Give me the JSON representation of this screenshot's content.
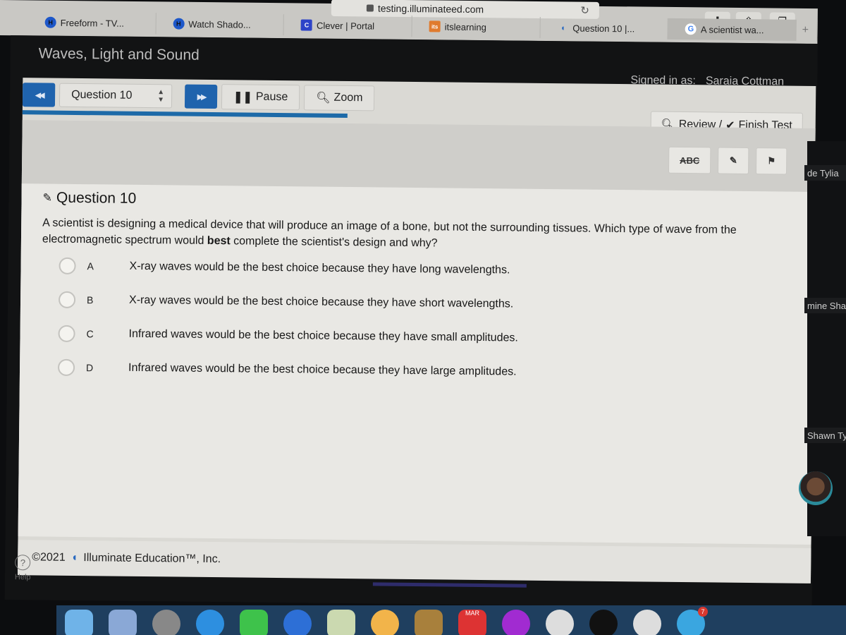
{
  "browser": {
    "url": "testing.illuminateed.com",
    "tabs": [
      {
        "label": "Freeform - TV...",
        "icon": "h-logo-icon"
      },
      {
        "label": "Watch Shado...",
        "icon": "h-logo-icon"
      },
      {
        "label": "Clever | Portal",
        "icon": "clever-logo-icon"
      },
      {
        "label": "itslearning",
        "icon": "itslearning-logo-icon"
      },
      {
        "label": "Question 10 |...",
        "icon": "illuminate-logo-icon"
      },
      {
        "label": "A scientist wa...",
        "icon": "google-logo-icon"
      }
    ],
    "new_tab_label": "+",
    "favicon_glyphs": {
      "h": "H",
      "c": "C",
      "its": "its",
      "ill": "◖",
      "g": "G"
    }
  },
  "app": {
    "title": "Waves, Light and Sound",
    "signed_in_label": "Signed in as:",
    "user_name": "Saraia Cottman"
  },
  "toolbar": {
    "prev_label": "◀◀",
    "question_select": "Question 10",
    "next_label": "▶▶",
    "pause_label": "Pause",
    "zoom_label": "Zoom",
    "review_label": "Review /",
    "finish_label": "Finish Test",
    "progress_fraction": 0.41,
    "tools": {
      "abc": "ABC",
      "edit": "✎",
      "flag": "⚑"
    }
  },
  "question": {
    "heading": "Question 10",
    "stem_before": "A scientist is designing a medical device that will produce an image of a bone, but not the surrounding tissues. Which type of wave from the electromagnetic spectrum would ",
    "stem_bold": "best",
    "stem_after": " complete the scientist's design and why?",
    "choices": [
      {
        "letter": "A",
        "text": "X-ray waves would be the best choice because they have long wavelengths."
      },
      {
        "letter": "B",
        "text": "X-ray waves would be the best choice because they have short wavelengths."
      },
      {
        "letter": "C",
        "text": "Infrared waves would be the best choice because they have small amplitudes."
      },
      {
        "letter": "D",
        "text": "Infrared waves would be the best choice because they have large amplitudes."
      }
    ]
  },
  "footer": {
    "copyright": "©2021",
    "company": "Illuminate Education™, Inc."
  },
  "help": {
    "icon": "?",
    "label": "Help"
  },
  "participants": [
    "de Tylia",
    "mine Sha",
    "Shawn Tyre"
  ],
  "dock": {
    "calendar_month": "MAR",
    "badge_count": "7"
  },
  "colors": {
    "accent": "#1f63ad",
    "progress": "#1d6aa8"
  }
}
